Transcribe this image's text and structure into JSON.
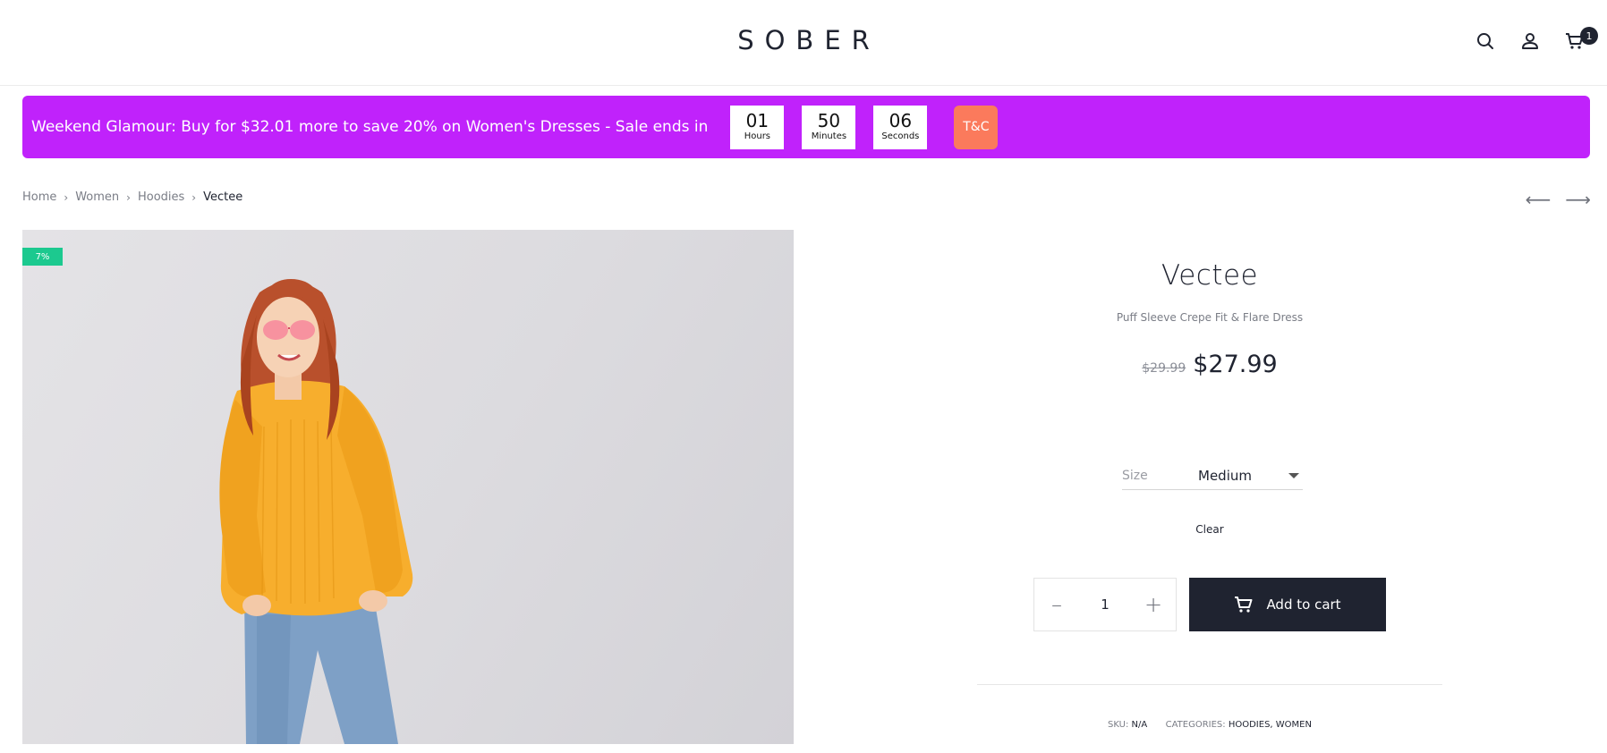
{
  "header": {
    "logo": "SOBER",
    "icons": [
      "search-icon",
      "user-icon",
      "cart-icon"
    ],
    "cart_count": "1"
  },
  "promo": {
    "text": "Weekend Glamour: Buy for $32.01 more to save 20% on Women's Dresses - Sale ends in",
    "countdown": [
      {
        "value": "01",
        "label": "Hours"
      },
      {
        "value": "50",
        "label": "Minutes"
      },
      {
        "value": "06",
        "label": "Seconds"
      }
    ],
    "tc_label": "T&C",
    "colors": {
      "background": "#c022fb",
      "tc_button": "#fb7a5c"
    }
  },
  "breadcrumb": [
    "Home",
    "Women",
    "Hoodies",
    "Vectee"
  ],
  "product": {
    "badge": "7%",
    "title": "Vectee",
    "subtitle": "Puff Sleeve Crepe Fit & Flare Dress",
    "old_price": "$29.99",
    "price": "$27.99",
    "size_label": "Size",
    "size_value": "Medium",
    "clear_label": "Clear",
    "quantity": "1",
    "add_to_cart": "Add to cart",
    "sku_label": "SKU:",
    "sku_value": "N/A",
    "categories_label": "CATEGORIES:",
    "categories_value": "HOODIES, WOMEN"
  }
}
